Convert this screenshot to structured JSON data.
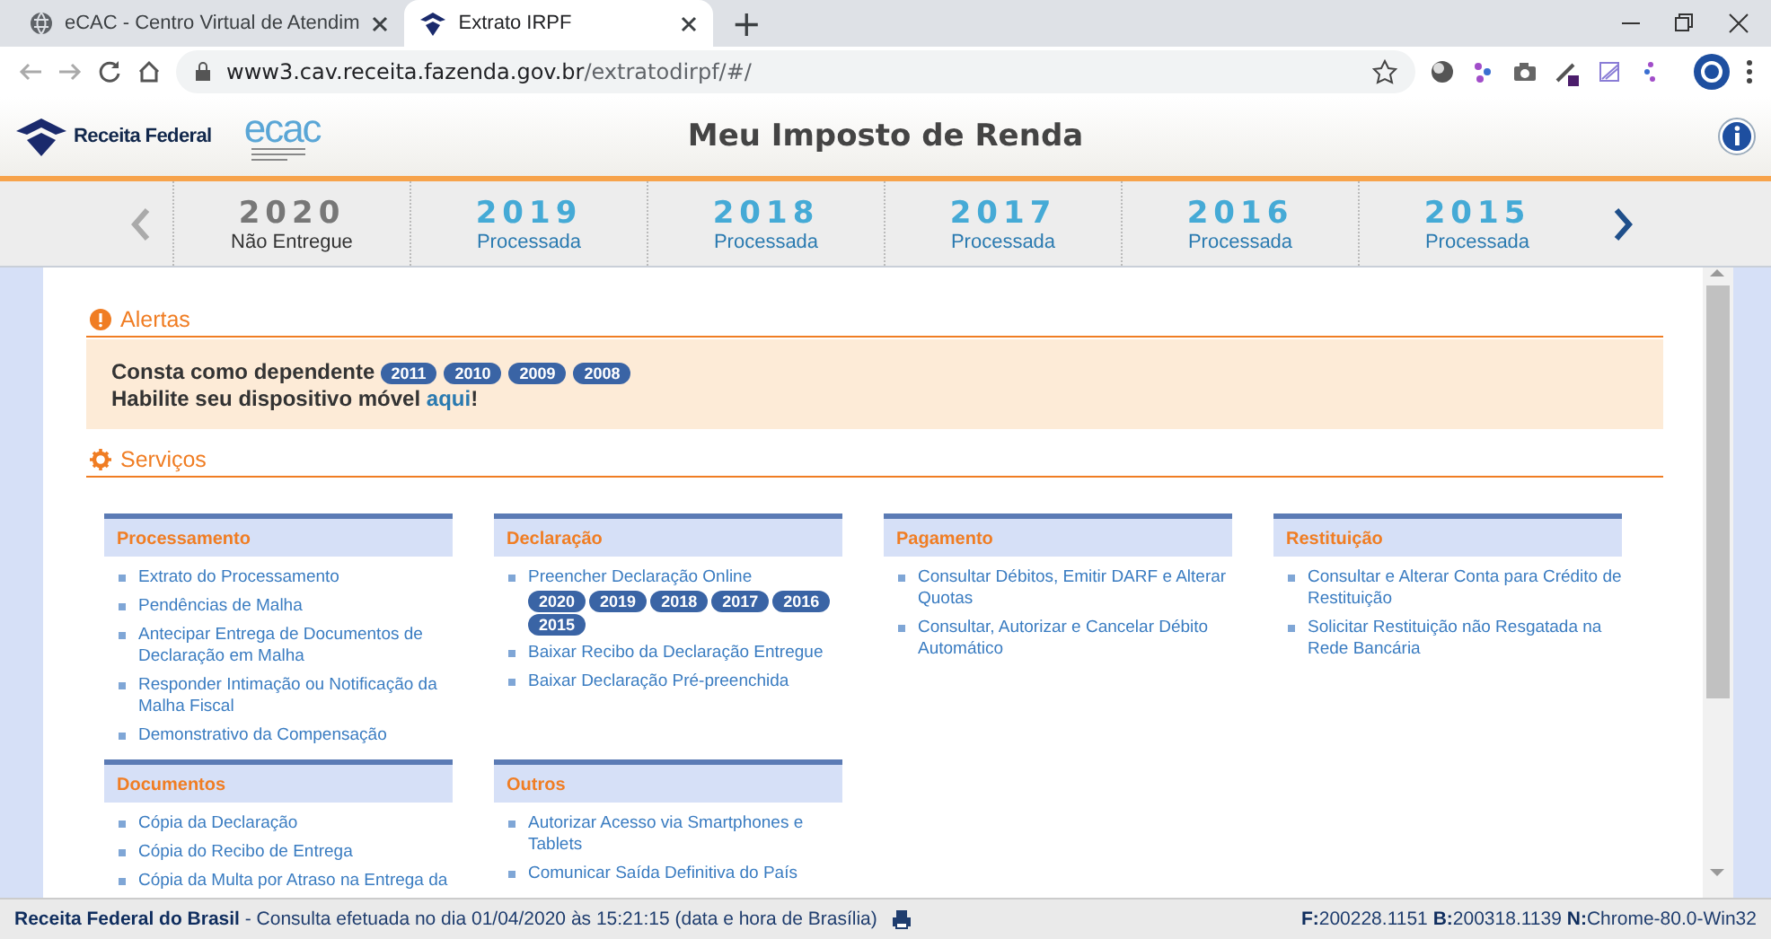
{
  "browser": {
    "tabs": [
      {
        "title": "eCAC - Centro Virtual de Atendim",
        "selected": false
      },
      {
        "title": "Extrato IRPF",
        "selected": true
      }
    ],
    "new_tab": "+",
    "url_host": "www3.cav.receita.fazenda.gov.br",
    "url_path": "/extratodirpf/#/"
  },
  "header": {
    "brand": "Receita Federal",
    "ecac_logo": "ecac",
    "title": "Meu Imposto de Renda"
  },
  "years": [
    {
      "year": "2020",
      "status": "Não Entregue",
      "kind": "pending"
    },
    {
      "year": "2019",
      "status": "Processada",
      "kind": "processed"
    },
    {
      "year": "2018",
      "status": "Processada",
      "kind": "processed"
    },
    {
      "year": "2017",
      "status": "Processada",
      "kind": "processed"
    },
    {
      "year": "2016",
      "status": "Processada",
      "kind": "processed"
    },
    {
      "year": "2015",
      "status": "Processada",
      "kind": "processed"
    }
  ],
  "alerts": {
    "title": "Alertas",
    "dependent_text": "Consta como dependente",
    "dependent_years": [
      "2011",
      "2010",
      "2009",
      "2008"
    ],
    "mobile_text": "Habilite seu dispositivo móvel ",
    "mobile_link": "aqui",
    "mobile_end": "!"
  },
  "services": {
    "title": "Serviços",
    "cards": [
      {
        "title": "Processamento",
        "items": [
          {
            "label": "Extrato do Processamento"
          },
          {
            "label": "Pendências de Malha"
          },
          {
            "label": "Antecipar Entrega de Documentos de Declaração em Malha"
          },
          {
            "label": "Responder Intimação ou Notificação da Malha Fiscal"
          },
          {
            "label": "Demonstrativo da Compensação"
          }
        ]
      },
      {
        "title": "Declaração",
        "items": [
          {
            "label": "Preencher Declaração Online",
            "chips": [
              "2020",
              "2019",
              "2018",
              "2017",
              "2016",
              "2015"
            ]
          },
          {
            "label": "Baixar Recibo da Declaração Entregue"
          },
          {
            "label": "Baixar Declaração Pré-preenchida"
          }
        ]
      },
      {
        "title": "Pagamento",
        "items": [
          {
            "label": "Consultar Débitos, Emitir DARF e Alterar Quotas"
          },
          {
            "label": "Consultar, Autorizar e Cancelar Débito Automático"
          }
        ]
      },
      {
        "title": "Restituição",
        "items": [
          {
            "label": "Consultar e Alterar Conta para Crédito de Restituição"
          },
          {
            "label": "Solicitar Restituição não Resgatada na Rede Bancária"
          }
        ]
      },
      {
        "title": "Documentos",
        "items": [
          {
            "label": "Cópia da Declaração"
          },
          {
            "label": "Cópia do Recibo de Entrega"
          },
          {
            "label": "Cópia da Multa por Atraso na Entrega da"
          }
        ]
      },
      {
        "title": "Outros",
        "items": [
          {
            "label": "Autorizar Acesso via Smartphones e Tablets"
          },
          {
            "label": "Comunicar Saída Definitiva do País"
          }
        ]
      }
    ]
  },
  "status_bar": {
    "left": "**Receita Federal do Brasil** - Consulta efetuada no dia 01/04/2020 às 15:21:15 (data e hora de Brasília)",
    "right": "**F:**200228.1151 **B:**200318.1139 **N:**Chrome-80.0-Win32"
  }
}
